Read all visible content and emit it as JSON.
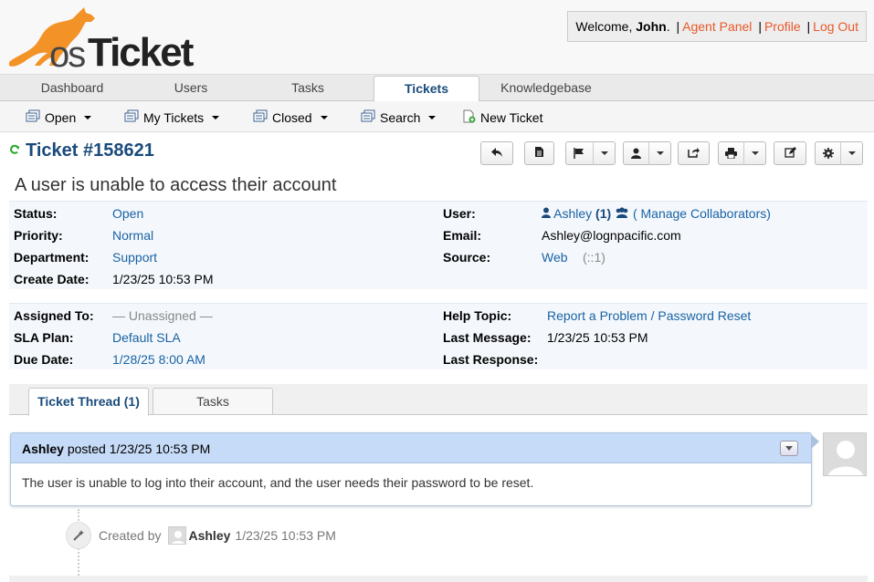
{
  "header": {
    "logo_os": "os",
    "logo_ticket": "Ticket",
    "welcome_prefix": "Welcome, ",
    "user_name": "John",
    "welcome_suffix": ".",
    "links": [
      "Agent Panel",
      "Profile",
      "Log Out"
    ]
  },
  "nav": {
    "tabs": [
      "Dashboard",
      "Users",
      "Tasks",
      "Tickets",
      "Knowledgebase"
    ],
    "active": "Tickets"
  },
  "subnav": {
    "items": [
      "Open",
      "My Tickets",
      "Closed",
      "Search",
      "New Ticket"
    ]
  },
  "ticket": {
    "title": "Ticket #158621",
    "subject": "A user is unable to access their account"
  },
  "info_left": {
    "status_label": "Status:",
    "status": "Open",
    "priority_label": "Priority:",
    "priority": "Normal",
    "department_label": "Department:",
    "department": "Support",
    "create_label": "Create Date:",
    "create": "1/23/25 10:53 PM"
  },
  "info_right": {
    "user_label": "User:",
    "user": "Ashley",
    "user_count": "(1)",
    "collaborators": "( Manage Collaborators)",
    "email_label": "Email:",
    "email": "Ashley@lognpacific.com",
    "source_label": "Source:",
    "source": "Web",
    "source_ip": "(::1)"
  },
  "assign_left": {
    "assigned_label": "Assigned To:",
    "assigned": "— Unassigned —",
    "sla_label": "SLA Plan:",
    "sla": "Default SLA",
    "due_label": "Due Date:",
    "due": "1/28/25 8:00 AM"
  },
  "assign_right": {
    "topic_label": "Help Topic:",
    "topic": "Report a Problem / Password Reset",
    "lastmsg_label": "Last Message:",
    "lastmsg": "1/23/25 10:53 PM",
    "lastresp_label": "Last Response:",
    "lastresp": ""
  },
  "thread_tabs": [
    "Ticket Thread (1)",
    "Tasks"
  ],
  "entry": {
    "author": "Ashley",
    "posted": "posted",
    "date": "1/23/25 10:53 PM",
    "body": "The user is unable to log into their account, and the user needs their password to be reset."
  },
  "event": {
    "created_by": "Created by",
    "who": "Ashley",
    "date": "1/23/25 10:53 PM"
  },
  "colors": {
    "link": "#1a62a4",
    "title": "#1a4b7c",
    "header_link": "#e8582a",
    "entry_head": "#c6dbf7"
  },
  "icons": [
    "refresh-icon",
    "reply-icon",
    "note-icon",
    "flag-icon",
    "user-icon",
    "transfer-icon",
    "print-icon",
    "edit-icon",
    "gear-icon"
  ]
}
